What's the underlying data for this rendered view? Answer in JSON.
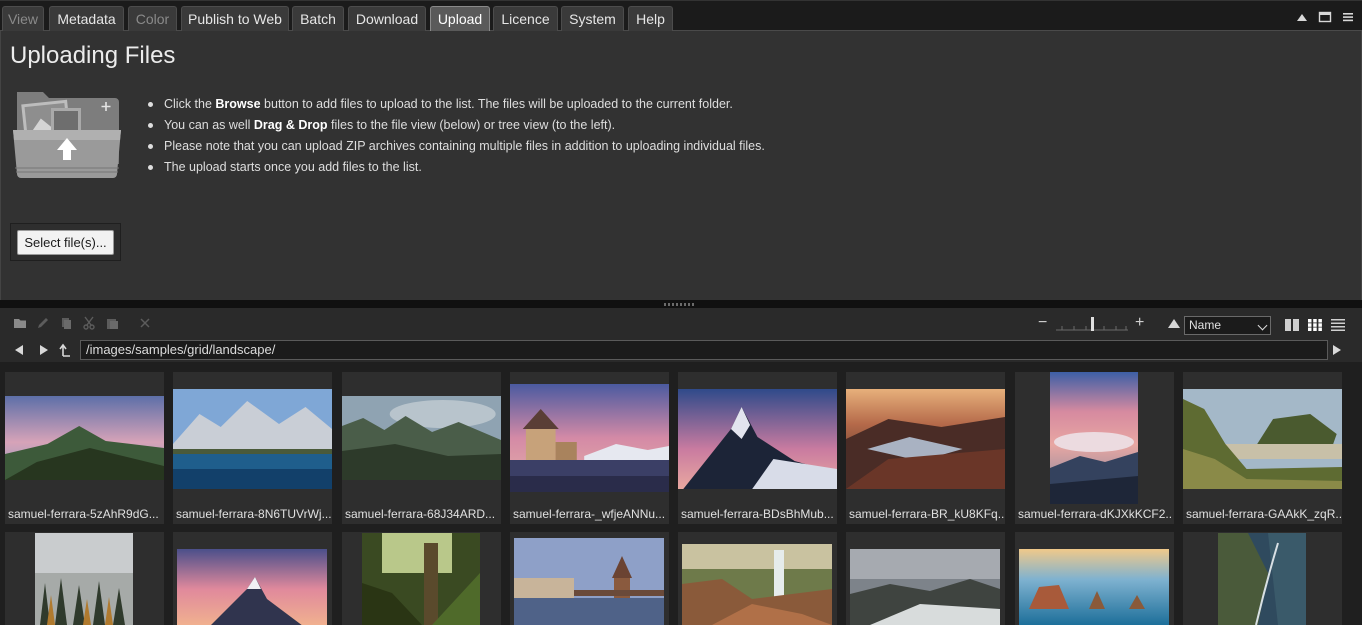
{
  "tabs": [
    {
      "label": "View",
      "state": "disabled"
    },
    {
      "label": "Metadata",
      "state": "normal"
    },
    {
      "label": "Color",
      "state": "disabled"
    },
    {
      "label": "Publish to Web",
      "state": "normal"
    },
    {
      "label": "Batch",
      "state": "normal"
    },
    {
      "label": "Download",
      "state": "normal"
    },
    {
      "label": "Upload",
      "state": "active"
    },
    {
      "label": "Licence",
      "state": "normal"
    },
    {
      "label": "System",
      "state": "normal"
    },
    {
      "label": "Help",
      "state": "normal"
    }
  ],
  "upload": {
    "title": "Uploading Files",
    "instructions": [
      {
        "pre": "Click the ",
        "bold": "Browse",
        "post": " button to add files to upload to the list. The files will be uploaded to the current folder."
      },
      {
        "pre": "You can as well ",
        "bold": "Drag & Drop",
        "post": " files to the file view (below) or tree view (to the left)."
      },
      {
        "pre": "Please note that you can upload ZIP archives containing multiple files in addition to uploading individual files.",
        "bold": "",
        "post": ""
      },
      {
        "pre": "The upload starts once you add files to the list.",
        "bold": "",
        "post": ""
      }
    ],
    "select_button": "Select file(s)..."
  },
  "toolbar": {
    "zoom_minus": "−",
    "zoom_plus": "+",
    "sort_value": "Name"
  },
  "path": {
    "value": "/images/samples/grid/landscape/"
  },
  "files_row1": [
    "samuel-ferrara-5zAhR9dG...",
    "samuel-ferrara-8N6TUVrWj...",
    "samuel-ferrara-68J34ARD...",
    "samuel-ferrara-_wfjeANNu...",
    "samuel-ferrara-BDsBhMub...",
    "samuel-ferrara-BR_kU8KFq...",
    "samuel-ferrara-dKJXkKCF2...",
    "samuel-ferrara-GAAkK_zqR..."
  ],
  "colors": {
    "active_tab": "#5a5a5a",
    "panel_bg": "#323232",
    "thumb_bg": "#2e2e2e"
  }
}
